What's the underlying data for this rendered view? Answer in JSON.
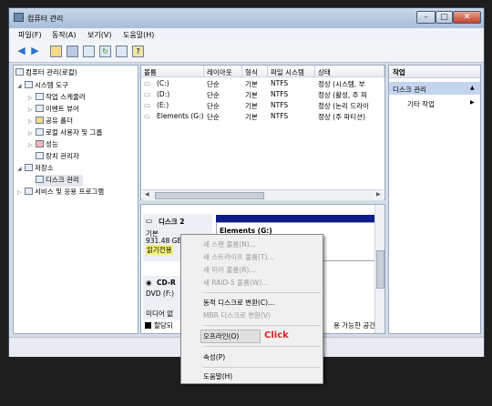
{
  "window": {
    "title": "컴퓨터 관리",
    "minimize": "–",
    "maximize": "□",
    "close": "✕"
  },
  "menubar": [
    "파일(F)",
    "동작(A)",
    "보기(V)",
    "도움말(H)"
  ],
  "toolbar_icons": [
    "back-arrow-icon",
    "forward-arrow-icon",
    "up-folder-icon",
    "show-hide-tree-icon",
    "properties-icon",
    "refresh-icon",
    "export-icon",
    "help-icon"
  ],
  "tree": {
    "root": "컴퓨터 관리(로컬)",
    "system_tools": "시스템 도구",
    "task_scheduler": "작업 스케줄러",
    "event_viewer": "이벤트 뷰어",
    "shared_folders": "공유 폴더",
    "local_users": "로컬 사용자 및 그룹",
    "performance": "성능",
    "device_manager": "장치 관리자",
    "storage": "저장소",
    "disk_management": "디스크 관리",
    "services": "서비스 및 응용 프로그램"
  },
  "volume_list": {
    "columns": [
      "볼륨",
      "레이아웃",
      "형식",
      "파일 시스템",
      "상태"
    ],
    "rows": [
      [
        "(C:)",
        "단순",
        "기본",
        "NTFS",
        "정상 (시스템, 부"
      ],
      [
        "(D:)",
        "단순",
        "기본",
        "NTFS",
        "정상 (활성, 주 피"
      ],
      [
        "(E:)",
        "단순",
        "기본",
        "NTFS",
        "정상 (논리 드라이"
      ],
      [
        "Elements (G:)",
        "단순",
        "기본",
        "NTFS",
        "정상 (주 파티션)"
      ]
    ]
  },
  "disk_panel": {
    "disk2_name": "디스크 2",
    "disk2_type": "기본",
    "disk2_size": "931.48 GB",
    "disk2_status": "읽기전용",
    "partition_label": "Elements  (G:)",
    "cdrom_name": "CD-R",
    "cdrom_drive": "DVD (F:)",
    "cdrom_media": "미디어 없",
    "legend_unalloc": "할당되",
    "legend_avail": "용 가능한 공간"
  },
  "actions": {
    "header": "작업",
    "section": "디스크 관리",
    "other": "기타 작업",
    "collapse_glyph": "▲",
    "more_glyph": "▶"
  },
  "context_menu": {
    "new_spanned": "새 스팬 볼륨(N)...",
    "new_striped": "새 스트라이프 볼륨(T)...",
    "new_mirror": "새 미러 볼륨(R)...",
    "new_raid5": "새 RAID-5 볼륨(W)...",
    "convert_dynamic": "동적 디스크로 변환(C)...",
    "convert_mbr": "MBR 디스크로 변환(V)",
    "offline": "오프라인(O)",
    "properties": "속성(P)",
    "help": "도움말(H)"
  },
  "annotation": {
    "click_label": "Click",
    "color": "#e02020"
  }
}
